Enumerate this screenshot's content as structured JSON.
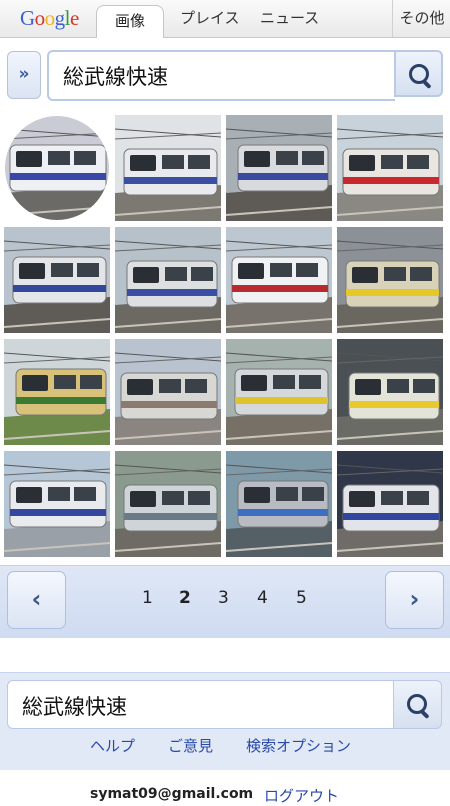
{
  "header": {
    "logo_letters": [
      {
        "ch": "G",
        "color": "#3b63d3"
      },
      {
        "ch": "o",
        "color": "#d7362c"
      },
      {
        "ch": "o",
        "color": "#f0b418"
      },
      {
        "ch": "g",
        "color": "#3b63d3"
      },
      {
        "ch": "l",
        "color": "#2f9c3a"
      },
      {
        "ch": "e",
        "color": "#d7362c"
      }
    ],
    "tabs": [
      "画像",
      "プレイス",
      "ニュース",
      "その他"
    ]
  },
  "search": {
    "expand_label": "»",
    "query": "総武線快速"
  },
  "results": {
    "thumbs": [
      {
        "sky": "#c9ccd4",
        "body": "#eef0f4",
        "stripe": "#3948a6",
        "ground": "#6b6a66",
        "circle": true
      },
      {
        "sky": "#dfe3e6",
        "body": "#e8eaee",
        "stripe": "#3b4fa2",
        "ground": "#7c7872"
      },
      {
        "sky": "#a8b0b6",
        "body": "#d8dadd",
        "stripe": "#3b49a0",
        "ground": "#5e5a55"
      },
      {
        "sky": "#c8d2da",
        "body": "#e9e5e1",
        "stripe": "#c9282e",
        "ground": "#8a8882"
      },
      {
        "sky": "#b9c3ce",
        "body": "#e3e5e8",
        "stripe": "#33479d",
        "ground": "#5f5c57"
      },
      {
        "sky": "#b6c1c9",
        "body": "#dedfe1",
        "stripe": "#3a4fa4",
        "ground": "#6c6963"
      },
      {
        "sky": "#bcc7d2",
        "body": "#f0f1f3",
        "stripe": "#b92a30",
        "ground": "#77736c"
      },
      {
        "sky": "#8c9198",
        "body": "#d8d3b8",
        "stripe": "#e6c72a",
        "ground": "#6a6660"
      },
      {
        "sky": "#cfd6d9",
        "body": "#d8c27a",
        "stripe": "#3a7a33",
        "ground": "#6d8a4a"
      },
      {
        "sky": "#b8c3cf",
        "body": "#d7d7d4",
        "stripe": "#8c7a70",
        "ground": "#8a8580"
      },
      {
        "sky": "#a5b2ae",
        "body": "#d5d8da",
        "stripe": "#e0c22c",
        "ground": "#777066"
      },
      {
        "sky": "#4a5054",
        "body": "#e4e3d8",
        "stripe": "#e8c82a",
        "ground": "#6b6b66"
      },
      {
        "sky": "#b5c6d6",
        "body": "#e8eaee",
        "stripe": "#34489f",
        "ground": "#9aa0a8"
      },
      {
        "sky": "#8a9a8e",
        "body": "#cfd4d8",
        "stripe": "#6a7a86",
        "ground": "#6e6a64"
      },
      {
        "sky": "#7e9aa8",
        "body": "#b8bcc2",
        "stripe": "#3d6ec2",
        "ground": "#555f66"
      },
      {
        "sky": "#2f3748",
        "body": "#e2e4ea",
        "stripe": "#31469e",
        "ground": "#6f6c68"
      }
    ]
  },
  "pager": {
    "prev_icon": "‹",
    "next_icon": "›",
    "pages": [
      "1",
      "2",
      "3",
      "4",
      "5"
    ],
    "current": "2"
  },
  "bottom_search": {
    "query": "総武線快速"
  },
  "links": [
    "ヘルプ",
    "ご意見",
    "検索オプション"
  ],
  "account": {
    "email": "symat09@gmail.com",
    "logout": "ログアウト"
  }
}
